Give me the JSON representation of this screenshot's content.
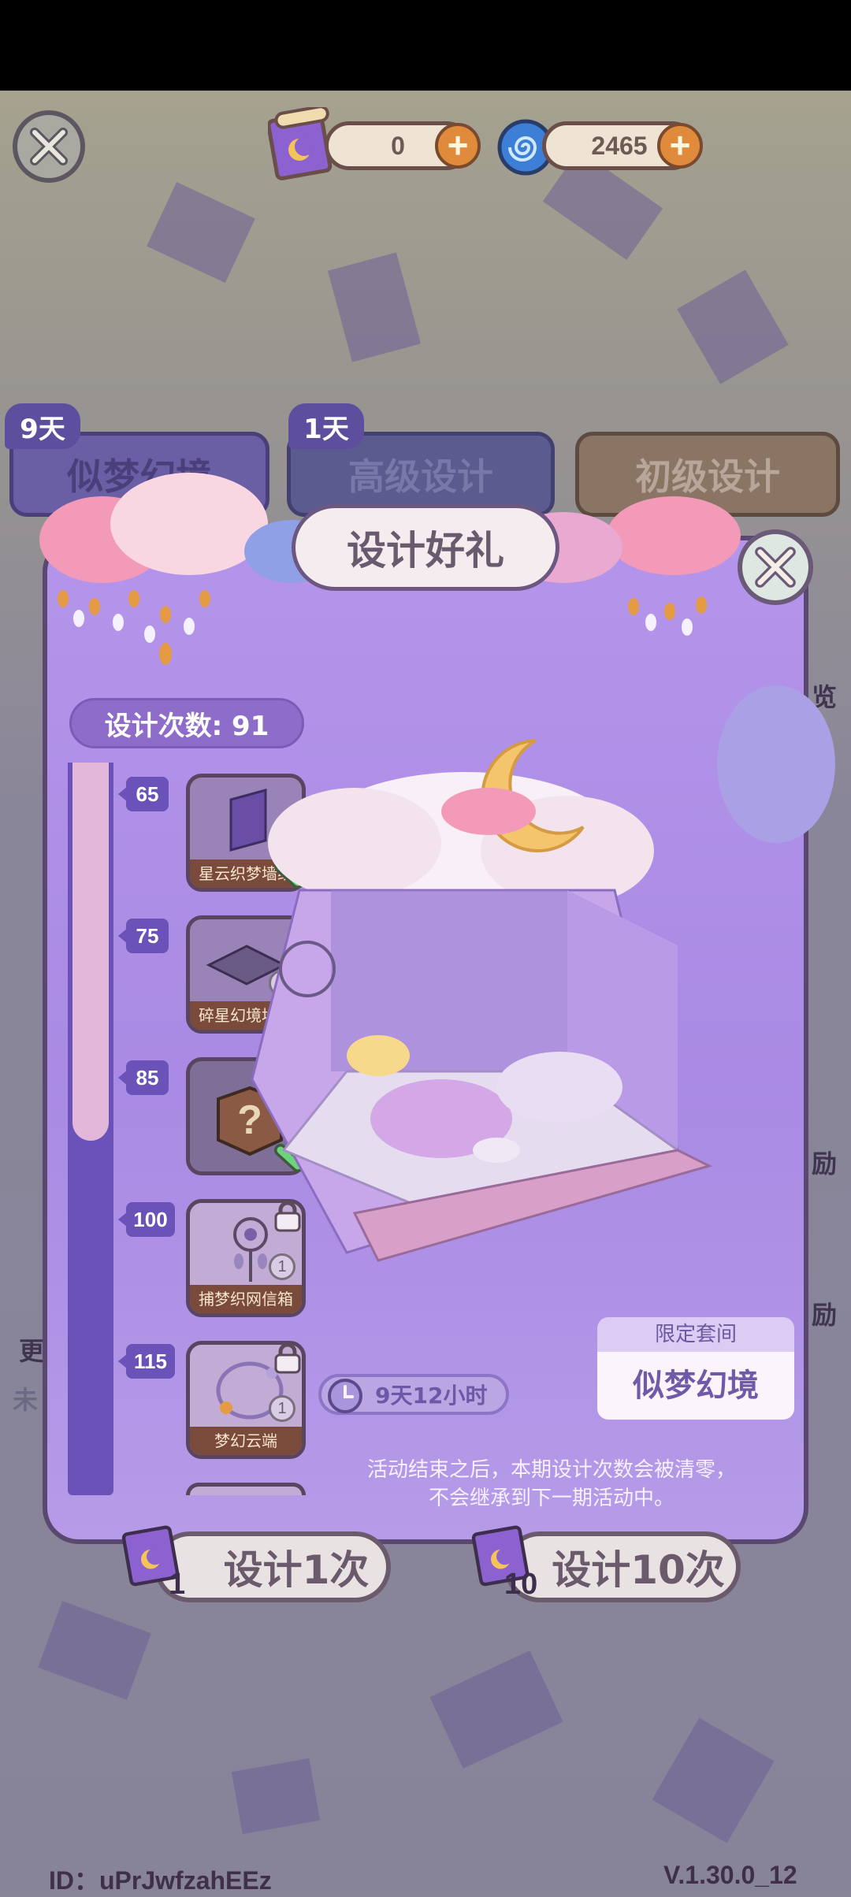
{
  "header": {
    "ticket_count": "0",
    "spiral_count": "2465"
  },
  "tabs": [
    {
      "label": "似梦幻境",
      "days": "9天"
    },
    {
      "label": "高级设计",
      "days": "1天"
    },
    {
      "label": "初级设计",
      "days": ""
    }
  ],
  "panel": {
    "title": "设计好礼",
    "design_count": "设计次数: 91",
    "tiers": [
      {
        "threshold": "65",
        "name": "星云织梦墙纸",
        "qty": "1",
        "status": "claimed"
      },
      {
        "threshold": "75",
        "name": "碎星幻境地毯",
        "qty": "1",
        "status": "claimed"
      },
      {
        "threshold": "85",
        "name": "",
        "qty": "",
        "status": "claimed"
      },
      {
        "threshold": "100",
        "name": "捕梦织网信箱",
        "qty": "1",
        "status": "locked"
      },
      {
        "threshold": "115",
        "name": "梦幻云端",
        "qty": "1",
        "status": "locked"
      }
    ],
    "timer": "9天12小时",
    "suite_header": "限定套间",
    "suite_name": "似梦幻境",
    "note_line1": "活动结束之后，本期设计次数会被清零，",
    "note_line2": "不会继承到下一期活动中。"
  },
  "actions": {
    "design_once": "设计1次",
    "design_once_cost": "1",
    "design_ten": "设计10次",
    "design_ten_cost": "10"
  },
  "side": {
    "right_peek_1": "览",
    "right_peek_2": "励",
    "right_peek_3": "励",
    "left_peek_1": "更",
    "left_peek_2": "未"
  },
  "footer": {
    "user_id": "ID：uPrJwfzahEEz",
    "version": "V.1.30.0_12"
  },
  "colors": {
    "panel": "#ae90e6",
    "accent_orange": "#e08a3c",
    "track": "#6a52b8",
    "check_green": "#5cc46a"
  }
}
